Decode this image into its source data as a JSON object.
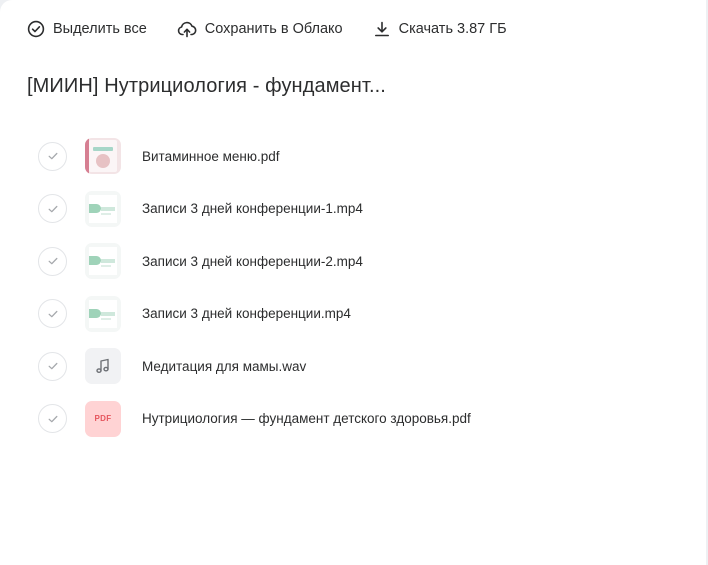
{
  "toolbar": {
    "select_all_label": "Выделить все",
    "save_to_cloud_label": "Сохранить в Облако",
    "download_label": "Скачать 3.87 ГБ"
  },
  "folder": {
    "title": "[МИИН] Нутрициология - фундамент..."
  },
  "files": [
    {
      "name": "Витаминное меню.pdf",
      "thumbnail": "pdf-preview"
    },
    {
      "name": "Записи 3 дней конференции-1.mp4",
      "thumbnail": "video-preview"
    },
    {
      "name": "Записи 3 дней конференции-2.mp4",
      "thumbnail": "video-preview"
    },
    {
      "name": "Записи 3 дней конференции.mp4",
      "thumbnail": "video-preview"
    },
    {
      "name": "Медитация для мамы.wav",
      "thumbnail": "music-note-icon"
    },
    {
      "name": "Нутрициология — фундамент детского здоровья.pdf",
      "thumbnail": "pdf-type-icon",
      "type_label": "PDF"
    }
  ],
  "icons": {
    "select_all": "check-circle-icon",
    "save_to_cloud": "cloud-upload-icon",
    "download": "download-icon",
    "row_check": "checkmark-icon"
  },
  "colors": {
    "text": "#2c2d2e",
    "check_border": "#e3e5e8",
    "pdf_badge_bg": "#ffd3d4",
    "pdf_badge_text": "#e6555d",
    "page_bg": "#ffffff",
    "outer_bg": "#eef0f3"
  }
}
